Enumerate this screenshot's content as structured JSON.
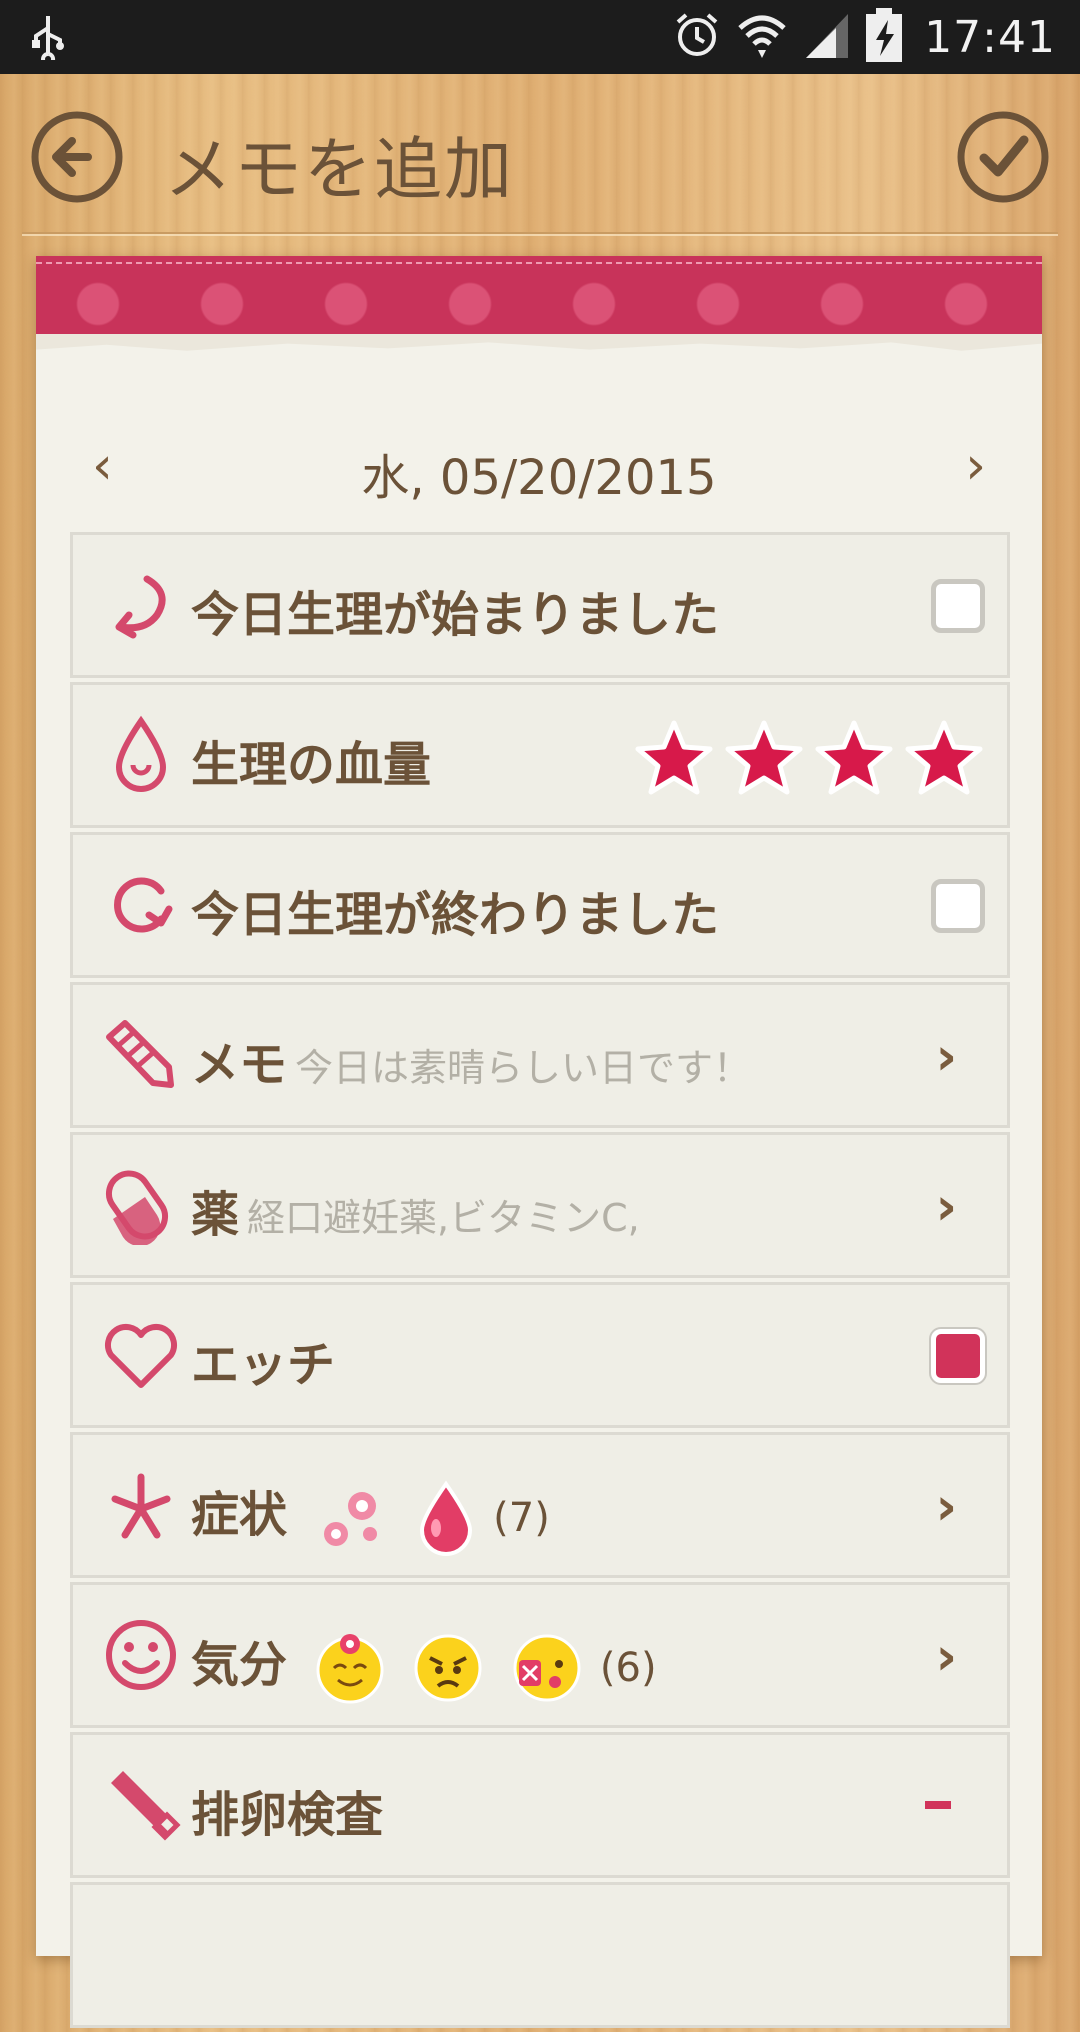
{
  "status_bar": {
    "time": "17:41"
  },
  "header": {
    "title": "メモを追加"
  },
  "date_nav": {
    "date": "水, 05/20/2015",
    "prev": "‹",
    "next": "›"
  },
  "rows": [
    {
      "label": "今日生理が始まりました",
      "control": "checkbox",
      "checked": false
    },
    {
      "label": "生理の血量",
      "control": "stars",
      "stars": 4
    },
    {
      "label": "今日生理が終わりました",
      "control": "checkbox",
      "checked": false
    },
    {
      "label": "メモ",
      "sub": "今日は素晴らしい日です！",
      "control": "chevron"
    },
    {
      "label": "薬",
      "sub": "経口避妊薬,ビタミンC,",
      "control": "chevron"
    },
    {
      "label": "エッチ",
      "control": "checkbox",
      "checked": true
    },
    {
      "label": "症状",
      "count": "(7)",
      "control": "chevron"
    },
    {
      "label": "気分",
      "count": "(6)",
      "control": "chevron"
    },
    {
      "label": "排卵検査",
      "control": "dash"
    }
  ],
  "chevron_glyph": "›",
  "icons": [
    "usb-icon",
    "alarm-icon",
    "wifi-icon",
    "signal-icon",
    "battery-icon",
    "back-arrow-icon",
    "checkmark-icon"
  ],
  "colors": {
    "accent": "#d1335a",
    "text_brown": "#6b5238",
    "wood": "#e2b47a"
  }
}
